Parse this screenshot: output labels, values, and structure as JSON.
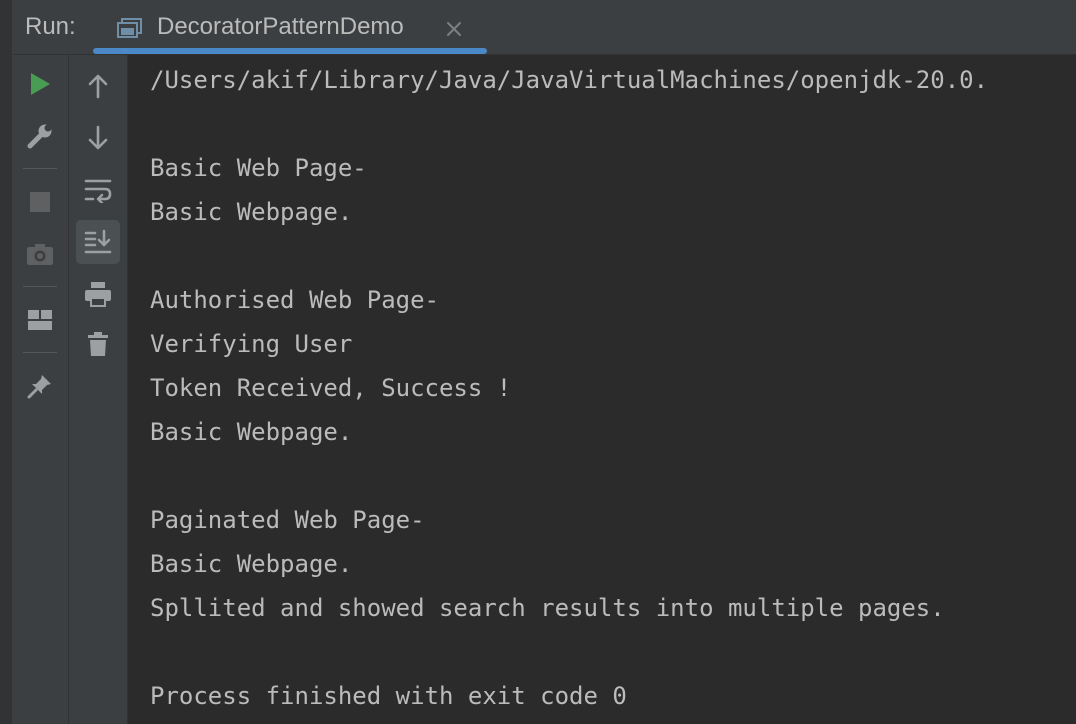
{
  "header": {
    "run_label": "Run:",
    "tab_title": "DecoratorPatternDemo"
  },
  "toolbar_left": [
    {
      "name": "rerun-icon",
      "color": "#499c54"
    },
    {
      "name": "wrench-icon"
    },
    {
      "name": "stop-icon"
    },
    {
      "name": "camera-icon"
    },
    {
      "name": "layout-icon"
    },
    {
      "name": "pin-icon"
    }
  ],
  "toolbar_right": [
    {
      "name": "arrow-up-icon"
    },
    {
      "name": "arrow-down-icon"
    },
    {
      "name": "soft-wrap-icon"
    },
    {
      "name": "scroll-to-end-icon",
      "active": true
    },
    {
      "name": "print-icon"
    },
    {
      "name": "trash-icon"
    }
  ],
  "console": {
    "lines": [
      "/Users/akif/Library/Java/JavaVirtualMachines/openjdk-20.0.",
      "",
      "Basic Web Page-",
      "Basic Webpage.",
      "",
      "Authorised Web Page-",
      "Verifying User",
      "Token Received, Success !",
      "Basic Webpage.",
      "",
      "Paginated Web Page-",
      "Basic Webpage.",
      "Spllited and showed search results into multiple pages.",
      "",
      "Process finished with exit code 0"
    ]
  },
  "colors": {
    "accent": "#4a88c7",
    "run_green": "#499c54",
    "text": "#bbbbbb",
    "console_bg": "#2b2b2b",
    "panel_bg": "#3c3f41"
  }
}
